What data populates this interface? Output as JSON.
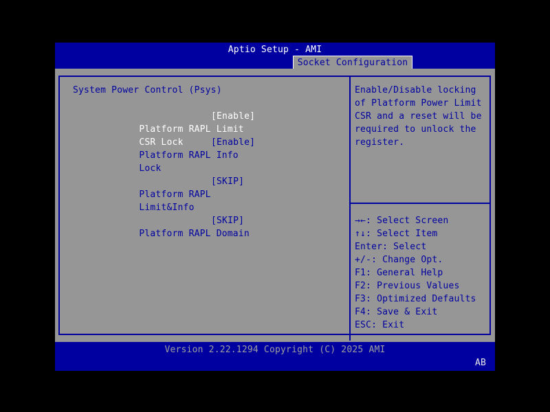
{
  "window": {
    "title": "Aptio Setup - AMI",
    "tab": "Socket Configuration"
  },
  "left_panel": {
    "header": "System Power Control (Psys)",
    "items": [
      {
        "line1": "Platform RAPL Limit",
        "line2": "CSR Lock",
        "value": "[Enable]",
        "selected": true
      },
      {
        "line1": "Platform RAPL Info",
        "line2": "Lock",
        "value": "[Enable]",
        "selected": false
      },
      {
        "line1": "Platform RAPL",
        "line2": "Limit&Info",
        "value": "[SKIP]",
        "selected": false
      },
      {
        "line1": "Platform RAPL Domain",
        "line2": "",
        "value": "[SKIP]",
        "selected": false
      }
    ]
  },
  "right_panel": {
    "help_lines": [
      "Enable/Disable locking",
      "of Platform Power Limit",
      "CSR and a reset will be",
      "required to unlock the",
      "register."
    ],
    "hotkeys": [
      "→←: Select Screen",
      "↑↓: Select Item",
      "Enter: Select",
      "+/-: Change Opt.",
      "F1: General Help",
      "F2: Previous Values",
      "F3: Optimized Defaults",
      "F4: Save & Exit",
      "ESC: Exit"
    ]
  },
  "footer": {
    "version": "Version 2.22.1294 Copyright (C) 2025 AMI",
    "corner": "AB"
  },
  "colors": {
    "bios_blue": "#0000A0",
    "body_gray": "#969696",
    "selected_text": "#FFFFFF",
    "footer_text": "#9E9E9E"
  }
}
